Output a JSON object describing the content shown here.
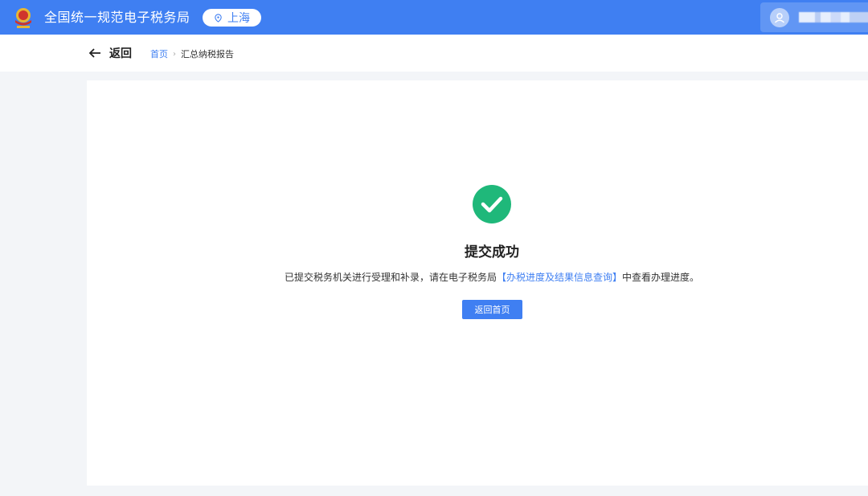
{
  "header": {
    "title": "全国统一规范电子税务局",
    "region": "上海",
    "brand_color": "#3f7ff2"
  },
  "nav": {
    "back_label": "返回",
    "breadcrumb": {
      "home": "首页",
      "separator": "›",
      "current": "汇总纳税报告"
    }
  },
  "result": {
    "title": "提交成功",
    "desc_prefix": "已提交税务机关进行受理和补录，请在电子税务局",
    "desc_link": "【办税进度及结果信息查询】",
    "desc_suffix": "中查看办理进度。",
    "button_label": "返回首页",
    "success_color": "#1fb87a"
  },
  "icons": {
    "logo": "tax-emblem-icon",
    "region": "location-pin-icon",
    "user": "user-avatar-icon",
    "back": "arrow-left-icon",
    "success": "check-circle-icon"
  }
}
